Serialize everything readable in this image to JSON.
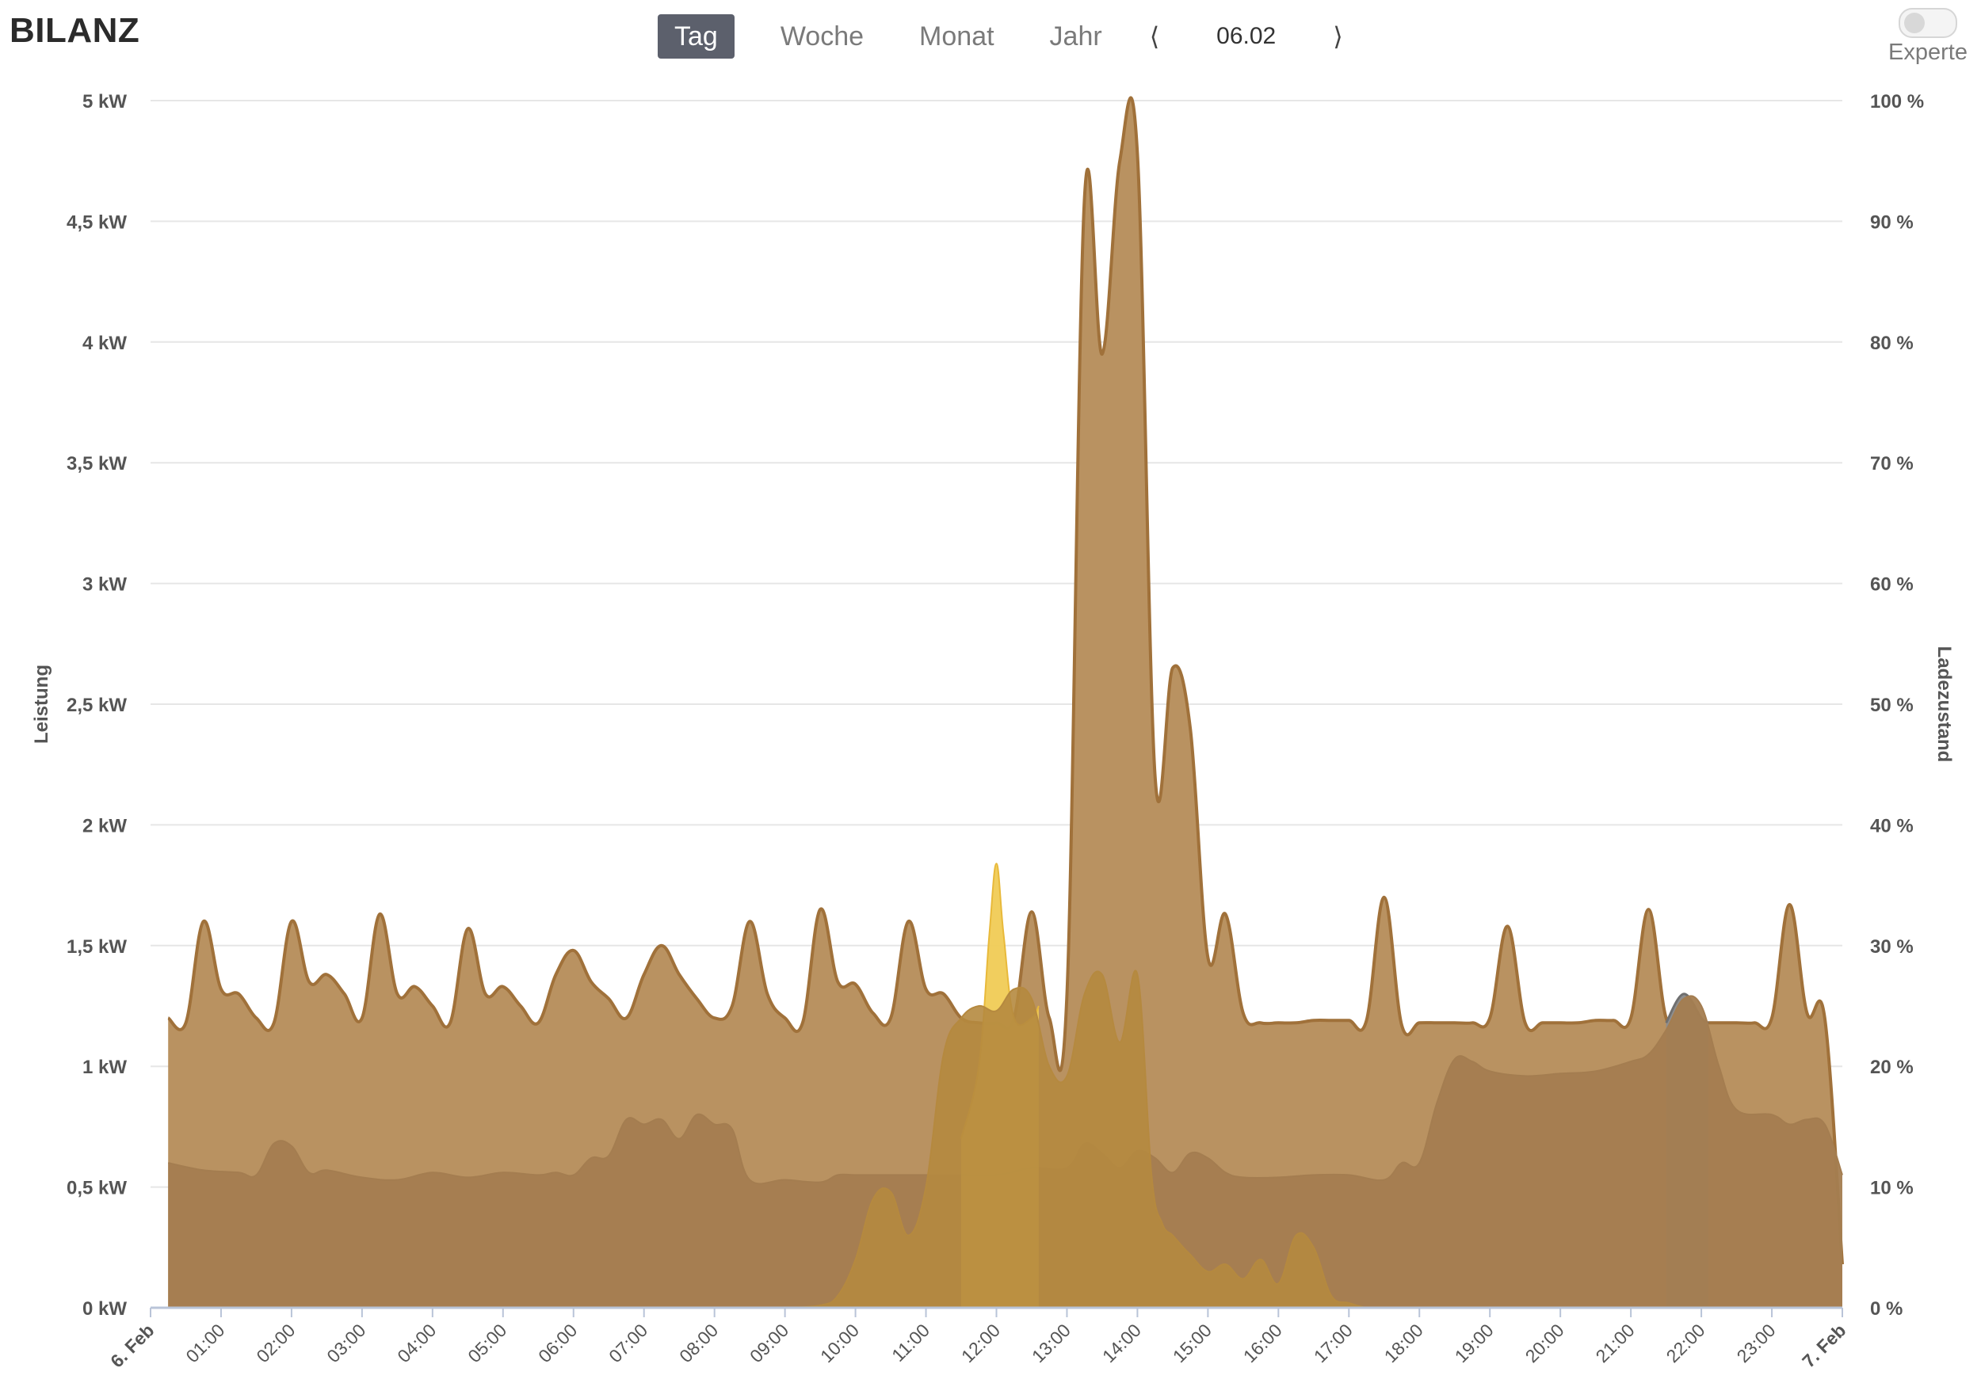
{
  "header": {
    "title": "BILANZ",
    "tabs": [
      {
        "label": "Tag",
        "active": true
      },
      {
        "label": "Woche",
        "active": false
      },
      {
        "label": "Monat",
        "active": false
      },
      {
        "label": "Jahr",
        "active": false
      }
    ],
    "prev_label": "⟨",
    "next_label": "⟩",
    "date": "06.02",
    "expert_label": "Experte",
    "expert_enabled": false
  },
  "chart_data": {
    "type": "area",
    "title": "",
    "ylabel": "Leistung",
    "y2label": "Ladezustand",
    "ylim": [
      0,
      5
    ],
    "y2lim": [
      0,
      100
    ],
    "xlim": [
      0,
      24
    ],
    "y_tick_labels": [
      "0 kW",
      "0,5 kW",
      "1 kW",
      "1,5 kW",
      "2 kW",
      "2,5 kW",
      "3 kW",
      "3,5 kW",
      "4 kW",
      "4,5 kW",
      "5 kW"
    ],
    "y2_tick_labels": [
      "0 %",
      "10 %",
      "20 %",
      "30 %",
      "40 %",
      "50 %",
      "60 %",
      "70 %",
      "80 %",
      "90 %",
      "100 %"
    ],
    "x_tick_labels": [
      "6. Feb",
      "01:00",
      "02:00",
      "03:00",
      "04:00",
      "05:00",
      "06:00",
      "07:00",
      "08:00",
      "09:00",
      "10:00",
      "11:00",
      "12:00",
      "13:00",
      "14:00",
      "15:00",
      "16:00",
      "17:00",
      "18:00",
      "19:00",
      "20:00",
      "21:00",
      "22:00",
      "23:00",
      "7. Feb"
    ],
    "x_bold_labels": [
      "6. Feb",
      "7. Feb"
    ],
    "grid": true,
    "legend": "none",
    "colors": {
      "consumption": "#b99261",
      "consumption_line": "#a0713a",
      "base": "#a47d50",
      "grid_import": "#8e8e8e",
      "pv_light": "#f0cb55",
      "pv": "#b5893f",
      "soc_line": "#6e7280",
      "gridline": "#e6e6e6",
      "axis": "#b9c4d8",
      "label": "#555555"
    },
    "series": [
      {
        "key": "consumption",
        "x": [
          0.25,
          0.5,
          0.75,
          1.0,
          1.25,
          1.5,
          1.75,
          2.0,
          2.25,
          2.5,
          2.75,
          3.0,
          3.25,
          3.5,
          3.75,
          4.0,
          4.25,
          4.5,
          4.75,
          5.0,
          5.25,
          5.5,
          5.75,
          6.0,
          6.25,
          6.5,
          6.75,
          7.0,
          7.25,
          7.5,
          7.75,
          8.0,
          8.25,
          8.5,
          8.75,
          9.0,
          9.25,
          9.5,
          9.75,
          10.0,
          10.25,
          10.5,
          10.75,
          11.0,
          11.25,
          11.5,
          11.75,
          12.0,
          12.25,
          12.5,
          12.75,
          13.0,
          13.25,
          13.5,
          13.75,
          14.0,
          14.25,
          14.5,
          14.75,
          15.0,
          15.25,
          15.5,
          15.75,
          16.0,
          16.25,
          16.5,
          16.75,
          17.0,
          17.25,
          17.5,
          17.75,
          18.0,
          18.25,
          18.5,
          18.75,
          19.0,
          19.25,
          19.5,
          19.75,
          20.0,
          20.25,
          20.5,
          20.75,
          21.0,
          21.25,
          21.5,
          21.75,
          22.0,
          22.25,
          22.5,
          22.75,
          23.0,
          23.25,
          23.5,
          23.75,
          24.0
        ],
        "values": [
          1.2,
          1.18,
          1.6,
          1.32,
          1.3,
          1.2,
          1.18,
          1.6,
          1.35,
          1.38,
          1.3,
          1.2,
          1.63,
          1.3,
          1.33,
          1.25,
          1.18,
          1.57,
          1.3,
          1.33,
          1.25,
          1.18,
          1.38,
          1.48,
          1.35,
          1.28,
          1.2,
          1.38,
          1.5,
          1.38,
          1.28,
          1.2,
          1.25,
          1.6,
          1.3,
          1.2,
          1.18,
          1.65,
          1.35,
          1.34,
          1.22,
          1.2,
          1.6,
          1.32,
          1.3,
          1.2,
          1.18,
          1.18,
          1.2,
          1.64,
          1.2,
          1.3,
          4.6,
          3.95,
          4.75,
          4.78,
          2.2,
          2.65,
          2.4,
          1.45,
          1.63,
          1.22,
          1.18,
          1.18,
          1.18,
          1.19,
          1.19,
          1.19,
          1.19,
          1.7,
          1.17,
          1.18,
          1.18,
          1.18,
          1.18,
          1.2,
          1.58,
          1.18,
          1.18,
          1.18,
          1.18,
          1.19,
          1.19,
          1.2,
          1.65,
          1.2,
          1.18,
          1.18,
          1.18,
          1.18,
          1.18,
          1.2,
          1.67,
          1.22,
          1.2,
          0.18
        ]
      },
      {
        "key": "base",
        "x": [
          0.25,
          0.75,
          1.25,
          1.5,
          1.75,
          2.0,
          2.25,
          2.5,
          3.0,
          3.5,
          4.0,
          4.5,
          5.0,
          5.5,
          5.75,
          6.0,
          6.25,
          6.5,
          6.75,
          7.0,
          7.25,
          7.5,
          7.75,
          8.0,
          8.25,
          8.5,
          9.0,
          9.5,
          9.75,
          10.0,
          10.5,
          11.0,
          11.5,
          12.0,
          12.5,
          13.0,
          13.25,
          13.5,
          13.75,
          14.0,
          14.25,
          14.5,
          14.75,
          15.0,
          15.25,
          15.5,
          16.0,
          16.5,
          17.0,
          17.5,
          17.75,
          18.0,
          18.25,
          18.5,
          18.75,
          19.0,
          19.5,
          20.0,
          20.5,
          21.0,
          21.25,
          21.5,
          21.75,
          22.0,
          22.25,
          22.5,
          23.0,
          23.25,
          23.5,
          23.75,
          24.0
        ],
        "values": [
          0.6,
          0.57,
          0.56,
          0.55,
          0.68,
          0.67,
          0.56,
          0.57,
          0.54,
          0.53,
          0.56,
          0.54,
          0.56,
          0.55,
          0.56,
          0.55,
          0.62,
          0.63,
          0.78,
          0.76,
          0.78,
          0.7,
          0.8,
          0.76,
          0.74,
          0.53,
          0.53,
          0.52,
          0.55,
          0.55,
          0.55,
          0.55,
          0.55,
          0.55,
          0.58,
          0.58,
          0.68,
          0.64,
          0.58,
          0.65,
          0.62,
          0.56,
          0.64,
          0.62,
          0.56,
          0.54,
          0.54,
          0.55,
          0.55,
          0.53,
          0.6,
          0.6,
          0.85,
          1.03,
          1.02,
          0.98,
          0.96,
          0.97,
          0.98,
          1.02,
          1.05,
          1.15,
          1.28,
          1.25,
          1.0,
          0.82,
          0.8,
          0.76,
          0.78,
          0.76,
          0.55
        ]
      },
      {
        "key": "grid_import",
        "x": [
          21.5,
          21.75,
          22.0,
          22.1
        ],
        "values": [
          1.18,
          1.3,
          1.2,
          1.18
        ]
      },
      {
        "key": "pv_light",
        "x": [
          11.5,
          11.75,
          11.9,
          12.0,
          12.1,
          12.25,
          12.5,
          12.6
        ],
        "values": [
          0.7,
          1.0,
          1.55,
          1.84,
          1.55,
          1.2,
          1.2,
          1.25
        ]
      },
      {
        "key": "pv",
        "x": [
          9.0,
          9.5,
          9.75,
          10.0,
          10.25,
          10.5,
          10.75,
          11.0,
          11.25,
          11.5,
          11.75,
          12.0,
          12.25,
          12.5,
          12.75,
          13.0,
          13.25,
          13.5,
          13.75,
          14.0,
          14.2,
          14.35,
          14.5,
          14.65,
          14.75,
          15.0,
          15.25,
          15.5,
          15.75,
          16.0,
          16.25,
          16.5,
          16.75,
          17.0,
          17.25,
          17.5,
          17.75,
          18.0
        ],
        "values": [
          0.0,
          0.01,
          0.05,
          0.2,
          0.45,
          0.48,
          0.3,
          0.5,
          1.05,
          1.2,
          1.25,
          1.23,
          1.32,
          1.28,
          1.0,
          0.96,
          1.3,
          1.38,
          1.1,
          1.38,
          0.55,
          0.35,
          0.3,
          0.25,
          0.22,
          0.15,
          0.18,
          0.12,
          0.2,
          0.1,
          0.3,
          0.25,
          0.05,
          0.02,
          0.0,
          0.0,
          0.0,
          0.0
        ]
      },
      {
        "key": "soc",
        "x": [
          0.25,
          24.0
        ],
        "values": [
          0.0,
          0.0
        ]
      }
    ]
  }
}
